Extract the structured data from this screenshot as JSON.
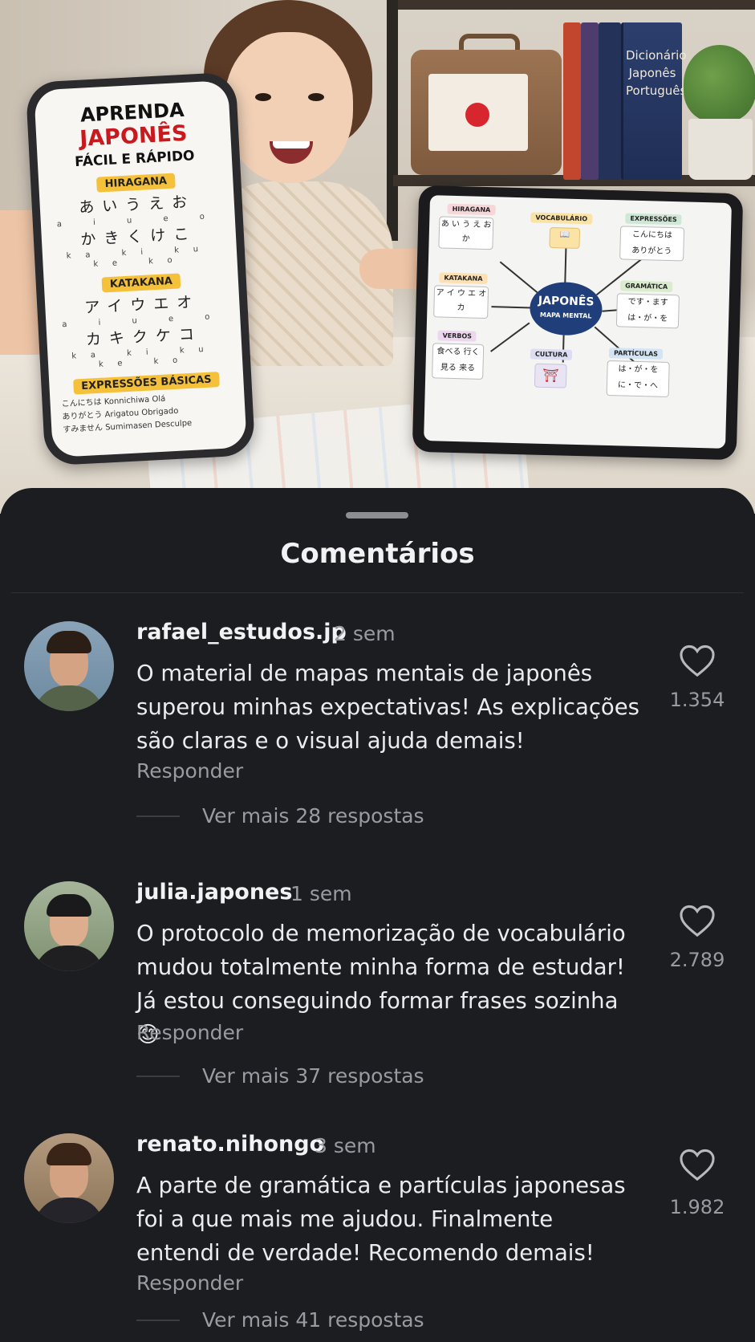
{
  "hero": {
    "book_title": "Dicionário Japonês Português",
    "phone": {
      "title_line1": "APRENDA",
      "title_line2": "JAPONÊS",
      "title_line3": "FÁCIL E RÁPIDO",
      "hiragana_label": "HIRAGANA",
      "hiragana_row1": "あいうえお",
      "hiragana_romaji1": "a i u e o",
      "hiragana_row2": "かきくけこ",
      "hiragana_romaji2": "ka ki ku ke ko",
      "katakana_label": "KATAKANA",
      "katakana_row1": "アイウエオ",
      "katakana_romaji1": "a i u e o",
      "katakana_row2": "カキクケコ",
      "katakana_romaji2": "ka ki ku ke ko",
      "expressions_label": "EXPRESSÕES BÁSICAS",
      "expression1": "こんにちは  Konnichiwa  Olá",
      "expression2": "ありがとう  Arigatou  Obrigado",
      "expression3": "すみません  Sumimasen  Desculpe"
    },
    "mindmap": {
      "center_title": "JAPONÊS",
      "center_subtitle": "MAPA MENTAL",
      "hiragana": "HIRAGANA",
      "hiragana_box": "あ い う え お か",
      "vocabulario": "VOCABULÁRIO",
      "expressoes": "EXPRESSÕES",
      "expressoes_box1": "こんにちは",
      "expressoes_box2": "ありがとう",
      "katakana": "KATAKANA",
      "katakana_box": "ア イ ウ エ オ カ",
      "gramatica": "GRAMÁTICA",
      "gramatica_box1": "です・ます",
      "gramatica_box2": "は・が・を",
      "verbos": "VERBOS",
      "verbos_box": "食べる 行く 見る 来る",
      "cultura": "CULTURA",
      "particulas": "PARTÍCULAS",
      "particulas_box1": "は・が・を",
      "particulas_box2": "に・で・へ"
    }
  },
  "sheet": {
    "title": "Comentários",
    "comments": [
      {
        "user": "rafael_estudos.jp",
        "time": "2 sem",
        "text": "O material de mapas mentais de japonês superou minhas expectativas! As explicações são claras e o visual ajuda demais!",
        "reply": "Responder",
        "more": "Ver mais 28 respostas",
        "likes": "1.354"
      },
      {
        "user": "julia.japones",
        "time": "1 sem",
        "text": "O protocolo de memorização de vocabulário mudou totalmente minha forma de estudar! Já estou conseguindo formar frases sozinha 😊",
        "reply": "Responder",
        "more": "Ver mais 37 respostas",
        "likes": "2.789"
      },
      {
        "user": "renato.nihongo",
        "time": "3 sem",
        "text": "A parte de gramática e partículas japonesas foi a que mais me ajudou. Finalmente entendi de verdade! Recomendo demais!",
        "reply": "Responder",
        "more": "Ver mais 41 respostas",
        "likes": "1.982"
      }
    ]
  },
  "colors": {
    "sheet_bg": "#1c1d21",
    "text_primary": "#f2f2f4",
    "text_secondary": "#9a9ba0",
    "accent_red": "#c8191f",
    "accent_yellow": "#f6c13a"
  },
  "icons": [
    "heart-outline-icon",
    "drag-handle-icon"
  ]
}
